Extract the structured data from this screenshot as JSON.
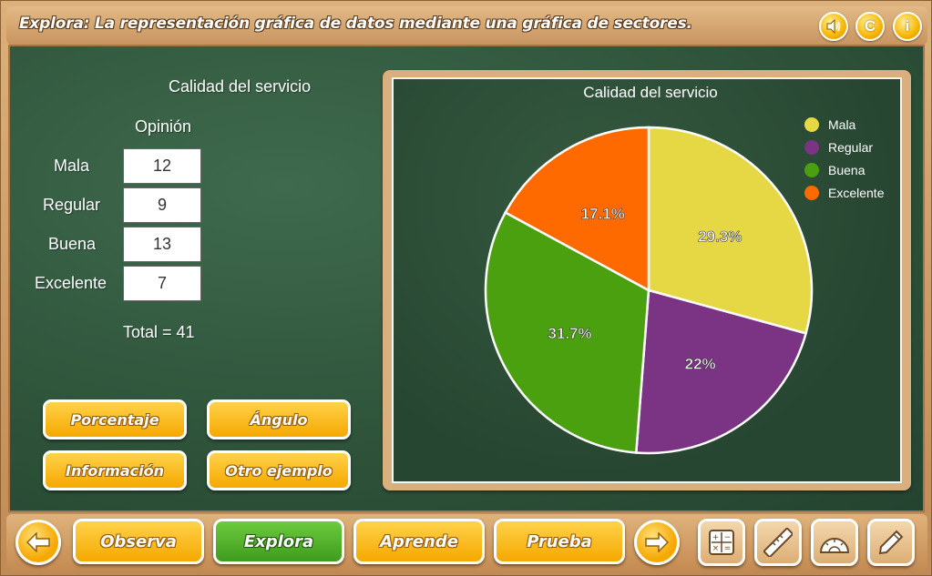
{
  "header": {
    "title": "Explora: La representación gráfica de datos mediante una gráfica de sectores.",
    "sound_icon": "speaker-icon",
    "credits_label": "C",
    "info_label": "i"
  },
  "table": {
    "title": "Calidad del servicio",
    "column_header": "Opinión",
    "rows": [
      {
        "label": "Mala",
        "value": "12"
      },
      {
        "label": "Regular",
        "value": "9"
      },
      {
        "label": "Buena",
        "value": "13"
      },
      {
        "label": "Excelente",
        "value": "7"
      }
    ],
    "total": "Total = 41"
  },
  "actions": {
    "percentage": "Porcentaje",
    "angle": "Ángulo",
    "information": "Información",
    "other_example": "Otro ejemplo"
  },
  "chart_data": {
    "type": "pie",
    "title": "Calidad del servicio",
    "categories": [
      "Mala",
      "Regular",
      "Buena",
      "Excelente"
    ],
    "values": [
      12,
      9,
      13,
      7
    ],
    "labels": [
      "29.3%",
      "22%",
      "31.7%",
      "17.1%"
    ],
    "colors": [
      "#e6d844",
      "#7b3384",
      "#4aa00e",
      "#ff6a00"
    ],
    "legend_position": "top-right"
  },
  "toolbar": {
    "back_icon": "arrow-left-icon",
    "observa": "Observa",
    "explora": "Explora",
    "aprende": "Aprende",
    "prueba": "Prueba",
    "next_icon": "arrow-right-icon",
    "tools": [
      "calculator-icon",
      "ruler-icon",
      "protractor-icon",
      "pencil-icon"
    ]
  }
}
